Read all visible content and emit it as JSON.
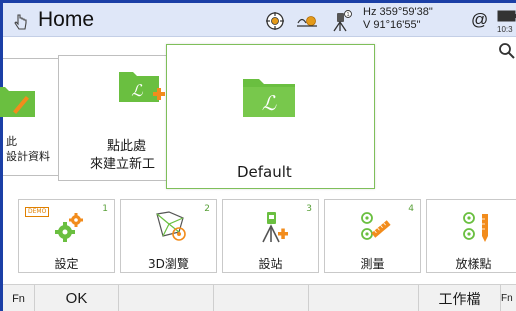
{
  "titlebar": {
    "title": "Home",
    "angles": {
      "hz": "Hz 359°59'38\"",
      "v": "V  91°16'55\""
    },
    "at_symbol": "@",
    "clock": "10:3"
  },
  "carousel": {
    "partial_card": {
      "line1": "此",
      "line2": "設計資料"
    },
    "new_project": {
      "line1": "點此處",
      "line2": "來建立新工"
    },
    "default_project": {
      "label": "Default"
    }
  },
  "apps": [
    {
      "label": "設定",
      "number": "1",
      "badge": "DEMO"
    },
    {
      "label": "3D瀏覽",
      "number": "2"
    },
    {
      "label": "設站",
      "number": "3"
    },
    {
      "label": "測量",
      "number": "4"
    },
    {
      "label": "放樣點",
      "number": "5"
    }
  ],
  "bottombar": {
    "fn_left": "Fn",
    "ok": "OK",
    "jobs": "工作檔",
    "fn_right": "Fn"
  },
  "colors": {
    "frame_blue": "#1b3fa6",
    "titlebar_bg": "#dfe7f8",
    "folder_green": "#6abf40",
    "accent_orange": "#f28c1c"
  }
}
